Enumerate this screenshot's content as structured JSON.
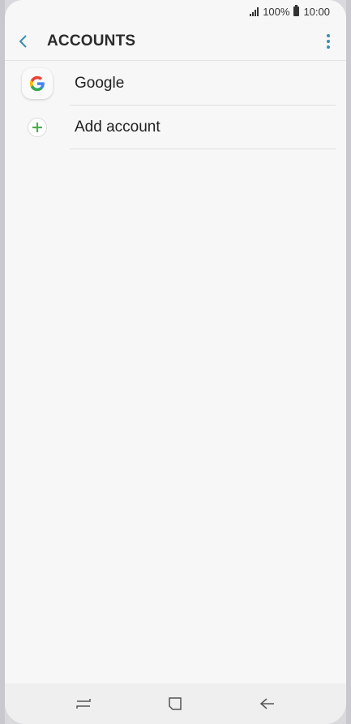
{
  "status_bar": {
    "battery": "100%",
    "time": "10:00",
    "icons": [
      "signal-icon",
      "battery-icon"
    ]
  },
  "app_bar": {
    "title": "ACCOUNTS",
    "icons": [
      "back-arrow-icon",
      "more-options-icon"
    ]
  },
  "accounts": {
    "items": [
      {
        "label": "Google",
        "icon": "google-icon"
      },
      {
        "label": "Add account",
        "icon": "plus-icon"
      }
    ]
  },
  "nav_bar": {
    "icons": [
      "recent-apps-icon",
      "home-icon",
      "back-icon"
    ]
  },
  "colors": {
    "accent": "#3a8fb0",
    "add_green": "#4caf50",
    "background": "#f7f7f7"
  }
}
